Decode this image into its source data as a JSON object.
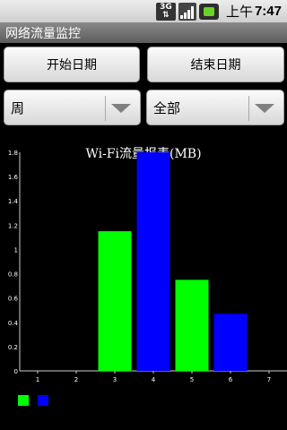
{
  "status_bar": {
    "network_label_top": "3G",
    "network_icon": "3g-data-icon",
    "signal_icon": "signal-strength-icon",
    "battery_icon": "battery-icon",
    "ampm": "上午",
    "time": "7:47"
  },
  "app": {
    "title": "网络流量监控"
  },
  "controls": {
    "start_date_label": "开始日期",
    "end_date_label": "结束日期",
    "period_selected": "周",
    "scope_selected": "全部"
  },
  "colors": {
    "series_a": "#00ff00",
    "series_b": "#0000ff"
  },
  "chart_data": {
    "type": "bar",
    "title": "Wi-Fi流量报表(MB)",
    "x": [
      1,
      2,
      3,
      4,
      5,
      6,
      7
    ],
    "x_ticks": [
      "1",
      "2",
      "3",
      "4",
      "5",
      "6",
      "7"
    ],
    "y_ticks": [
      "0",
      "0.2",
      "0.4",
      "0.6",
      "0.8",
      "1",
      "1.2",
      "1.4",
      "1.6",
      "1.8"
    ],
    "ylim": [
      0,
      1.8
    ],
    "bars": [
      {
        "x": 3,
        "value": 1.15,
        "series": 0
      },
      {
        "x": 4,
        "value": 1.8,
        "series": 1
      },
      {
        "x": 5,
        "value": 0.75,
        "series": 0
      },
      {
        "x": 6,
        "value": 0.47,
        "series": 1
      }
    ],
    "legend": {
      "placement": "bottom-left",
      "entries": [
        "",
        ""
      ]
    },
    "grid": false
  }
}
